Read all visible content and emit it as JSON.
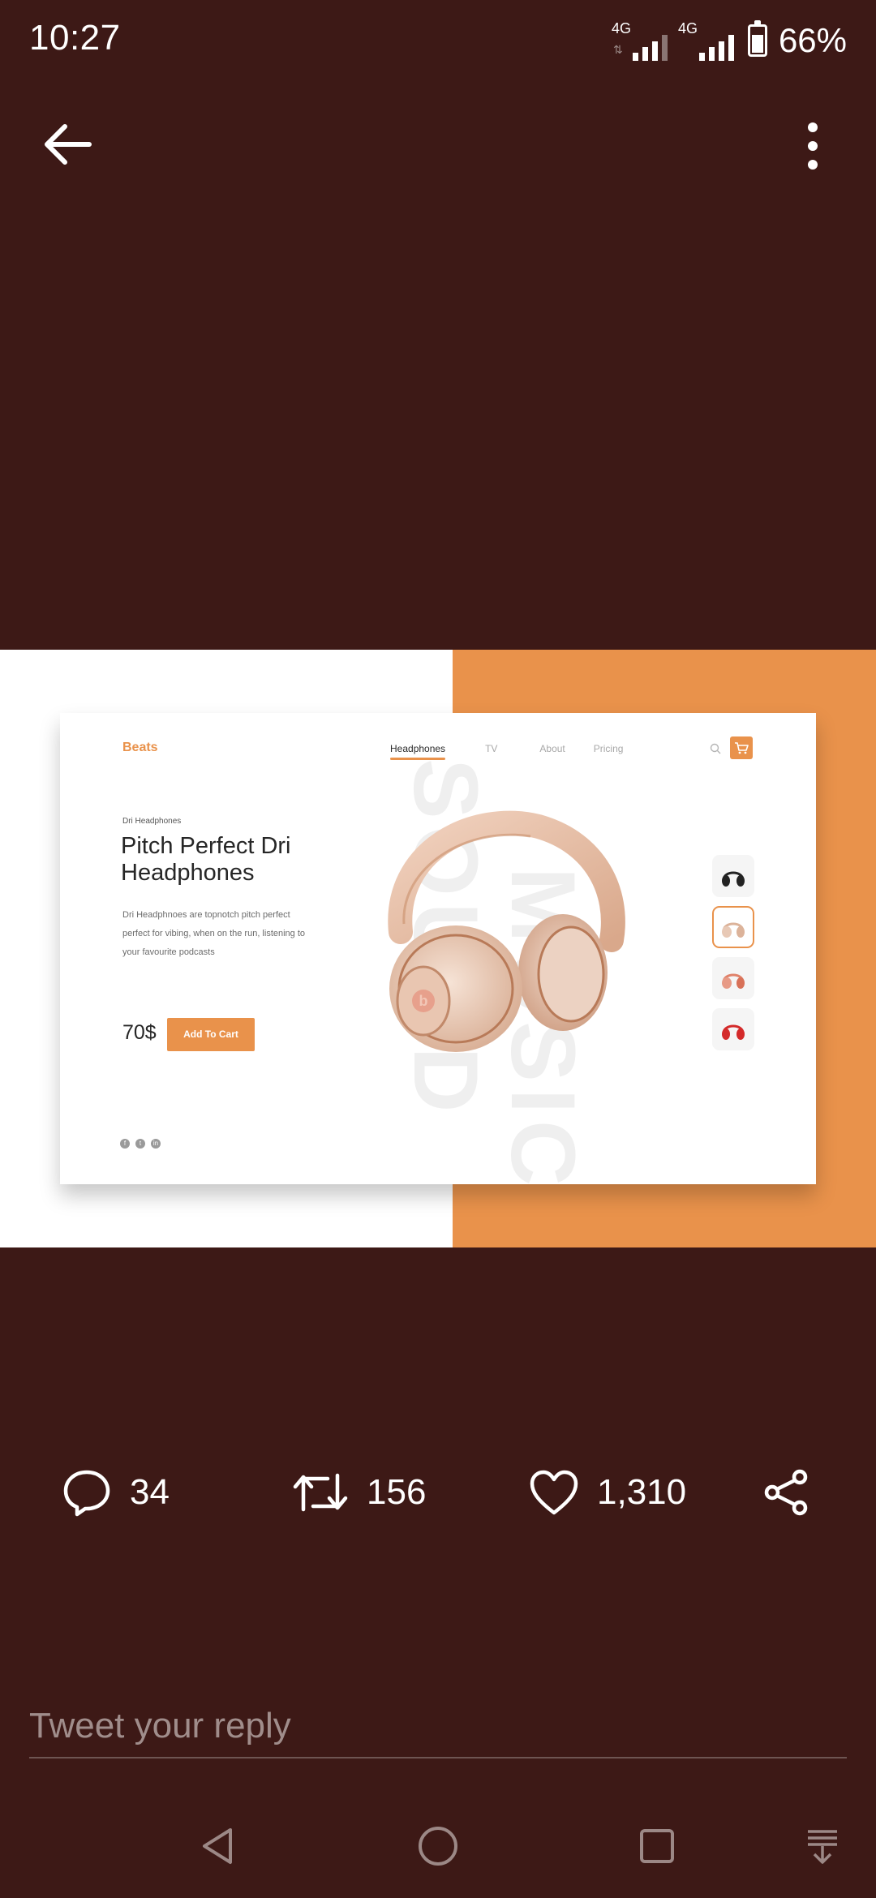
{
  "status_bar": {
    "time": "10:27",
    "network_1": "4G",
    "network_2": "4G",
    "battery": "66%",
    "battery_level": 0.66
  },
  "top_bar": {
    "back_icon": "arrow-left-icon",
    "menu_icon": "more-vertical-icon"
  },
  "shot": {
    "brand": "Beats",
    "nav": [
      "Headphones",
      "TV",
      "About",
      "Pricing"
    ],
    "kicker": "Dri Headphones",
    "headline_line1": "Pitch Perfect Dri",
    "headline_line2": "Headphones",
    "desc_line1": "Dri Headphnoes are topnotch pitch perfect",
    "desc_line2": "perfect for vibing, when on the run, listening to",
    "desc_line3": "your favourite podcasts",
    "price": "70$",
    "cta": "Add To Cart",
    "ghost_text_1": "SOUND",
    "ghost_text_2": "MUSIC",
    "social_icons": [
      "facebook-icon",
      "twitter-icon",
      "linkedin-icon"
    ],
    "accent_color": "#e9924b"
  },
  "actions": {
    "replies": "34",
    "retweets": "156",
    "likes": "1,310"
  },
  "reply_box": {
    "placeholder": "Tweet your reply"
  },
  "colors": {
    "background": "#3d1916",
    "accent": "#e9924b"
  }
}
